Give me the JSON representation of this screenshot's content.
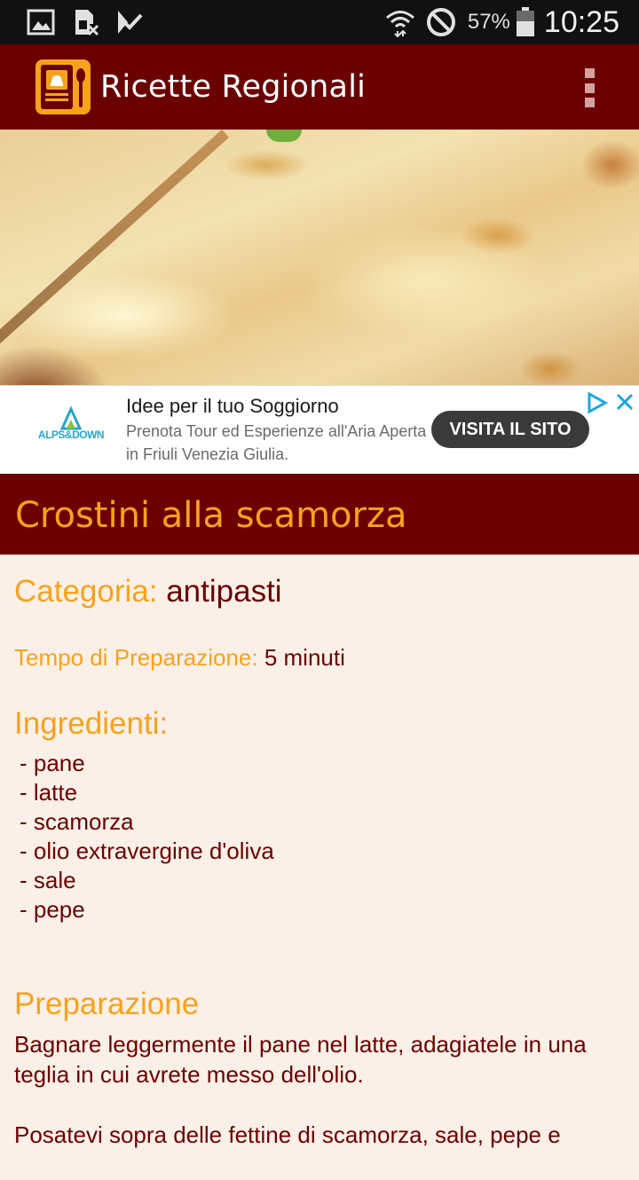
{
  "status_bar": {
    "left_icons": [
      "gallery-icon",
      "sim-card-icon",
      "check-icon"
    ],
    "right_icons": [
      "wifi-icon",
      "do-not-disturb-icon",
      "battery-icon"
    ],
    "battery_percent": "57%",
    "time": "10:25"
  },
  "app_bar": {
    "title": "Ricette Regionali",
    "logo_icon": "recipe-book-icon",
    "menu_icon": "overflow-menu-icon",
    "background_color": "#6b0000"
  },
  "hero": {
    "image_description_icon": "food-photo"
  },
  "ad": {
    "advertiser_logo_text": "ALPS&DOWN",
    "headline": "Idee per il tuo Soggiorno",
    "body_line_1": "Prenota Tour ed Esperienze all'Aria Aperta",
    "body_line_2": "in Friuli Venezia Giulia.",
    "cta_label": "VISITA IL SITO"
  },
  "recipe": {
    "title": "Crostini alla scamorza",
    "category_label": "Categoria:",
    "category_value": "antipasti",
    "prep_time_label": "Tempo di Preparazione:",
    "prep_time_value": "5 minuti",
    "ingredients_heading": "Ingredienti:",
    "ingredients": [
      "- pane",
      "- latte",
      "- scamorza",
      "- olio extravergine d'oliva",
      "- sale",
      "- pepe"
    ],
    "preparation_heading": "Preparazione",
    "preparation_paragraphs": [
      "Bagnare leggermente il pane nel latte, adagiatele in una teglia in cui avrete messo dell'olio.",
      "Posatevi sopra delle fettine di scamorza, sale, pepe e"
    ]
  },
  "colors": {
    "accent": "#f8a21b",
    "primary_dark": "#6b0000",
    "background": "#fbf0e8"
  }
}
